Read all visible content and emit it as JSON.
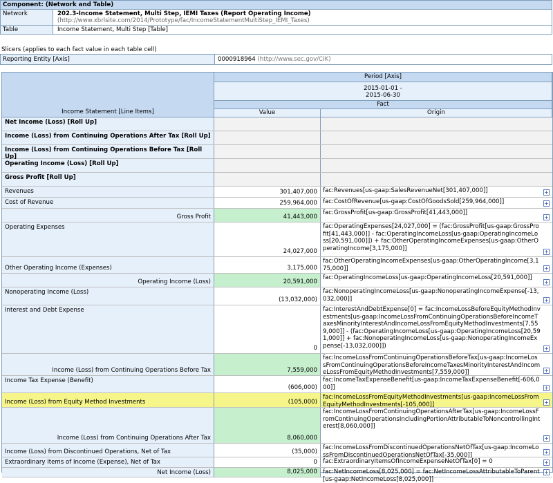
{
  "component": {
    "title": "Component: (Network and Table)",
    "network_label": "Network",
    "network_title": "202.3-Income Statement, Multi Step, IEMI Taxes (Report Operating Income)",
    "network_url": "(http://www.xbrlsite.com/2014/Prototype/fac/IncomeStatementMultiStep_IEMI_Taxes)",
    "table_label": "Table",
    "table_value": "Income Statement, Multi Step [Table]"
  },
  "slicers": {
    "label": "Slicers (applies to each fact value in each table cell)",
    "axis": "Reporting Entity [Axis]",
    "value": "0000918964",
    "value_url": "(http://www.sec.gov/CIK)"
  },
  "table": {
    "period_axis": "Period [Axis]",
    "period_line1": "2015-01-01 -",
    "period_line2": "2015-06-30",
    "fact": "Fact",
    "line_items_header": "Income Statement [Line Items]",
    "value_header": "Value",
    "origin_header": "Origin",
    "rows": [
      {
        "label": "Net Income (Loss) [Roll Up]",
        "value": "",
        "origin": ""
      },
      {
        "label": "Income (Loss) from Continuing Operations After Tax [Roll Up]",
        "value": "",
        "origin": ""
      },
      {
        "label": "Income (Loss) from Continuing Operations Before Tax [Roll Up]",
        "value": "",
        "origin": ""
      },
      {
        "label": "Operating Income (Loss) [Roll Up]",
        "value": "",
        "origin": ""
      },
      {
        "label": "Gross Profit [Roll Up]",
        "value": "",
        "origin": ""
      },
      {
        "label": "Revenues",
        "value": "301,407,000",
        "origin": "fac:Revenues[us-gaap:SalesRevenueNet[301,407,000]]"
      },
      {
        "label": "Cost of Revenue",
        "value": "259,964,000",
        "origin": "fac:CostOfRevenue[us-gaap:CostOfGoodsSold[259,964,000]]"
      },
      {
        "label": "Gross Profit",
        "value": "41,443,000",
        "origin": "fac:GrossProfit[us-gaap:GrossProfit[41,443,000]]"
      },
      {
        "label": "Operating Expenses",
        "value": "24,027,000",
        "origin": "fac:OperatingExpenses[24,027,000] = (fac:GrossProfit[us-gaap:GrossProfit[41,443,000]] - fac:OperatingIncomeLoss[us-gaap:OperatingIncomeLoss[20,591,000]]) + fac:OtherOperatingIncomeExpenses[us-gaap:OtherOperatingIncome[3,175,000]]"
      },
      {
        "label": "Other Operating Income (Expenses)",
        "value": "3,175,000",
        "origin": "fac:OtherOperatingIncomeExpenses[us-gaap:OtherOperatingIncome[3,175,000]]"
      },
      {
        "label": "Operating Income (Loss)",
        "value": "20,591,000",
        "origin": "fac:OperatingIncomeLoss[us-gaap:OperatingIncomeLoss[20,591,000]]"
      },
      {
        "label": "Nonoperating Income (Loss)",
        "value": "(13,032,000)",
        "origin": "fac:NonoperatingIncomeLoss[us-gaap:NonoperatingIncomeExpense[-13,032,000]]"
      },
      {
        "label": "Interest and Debt Expense",
        "value": "0",
        "origin": "fac:InterestAndDebtExpense[0] = fac:IncomeLossBeforeEquityMethodInvestments[us-gaap:IncomeLossFromContinuingOperationsBeforeIncomeTaxesMinorityInterestAndIncomeLossFromEquityMethodInvestments[7,559,000]] - (fac:OperatingIncomeLoss[us-gaap:OperatingIncomeLoss[20,591,000]] + fac:NonoperatingIncomeLoss[us-gaap:NonoperatingIncomeExpense[-13,032,000]])"
      },
      {
        "label": "Income (Loss) from Continuing Operations Before Tax",
        "value": "7,559,000",
        "origin": "fac:IncomeLossFromContinuingOperationsBeforeTax[us-gaap:IncomeLossFromContinuingOperationsBeforeIncomeTaxesMinorityInterestAndIncomeLossFromEquityMethodInvestments[7,559,000]]"
      },
      {
        "label": "Income Tax Expense (Benefit)",
        "value": "(606,000)",
        "origin": "fac:IncomeTaxExpenseBenefit[us-gaap:IncomeTaxExpenseBenefit[-606,000]]"
      },
      {
        "label": "Income (Loss) from Equity Method Investments",
        "value": "(105,000)",
        "origin": "fac:IncomeLossFromEquityMethodInvestments[us-gaap:IncomeLossFromEquityMethodInvestments[-105,000]]"
      },
      {
        "label": "Income (Loss) from Continuing Operations After Tax",
        "value": "8,060,000",
        "origin": "fac:IncomeLossFromContinuingOperationsAfterTax[us-gaap:IncomeLossFromContinuingOperationsIncludingPortionAttributableToNoncontrollingInterest[8,060,000]]"
      },
      {
        "label": "Income (Loss) from Discontinued Operations, Net of Tax",
        "value": "(35,000)",
        "origin": "fac:IncomeLossFromDiscontinuedOperationsNetOfTax[us-gaap:IncomeLossFromDiscontinuedOperationsNetOfTax[-35,000]]"
      },
      {
        "label": "Extraordinary Items of Income (Expense), Net of Tax",
        "value": "0",
        "origin": "fac:ExtraordinaryItemsOfIncomeExpenseNetOfTax[0] = 0"
      },
      {
        "label": "Net Income (Loss)",
        "value": "8,025,000",
        "origin": "fac:NetIncomeLoss[8,025,000] = fac:NetIncomeLossAttributableToParent[us-gaap:NetIncomeLoss[8,025,000]]"
      }
    ],
    "expand_glyph": "+"
  },
  "colors": {
    "header_blue": "#c5d9f1",
    "label_blue": "#e6f0fb",
    "total_green": "#c6efce",
    "highlight_yellow": "#f5f58a"
  }
}
